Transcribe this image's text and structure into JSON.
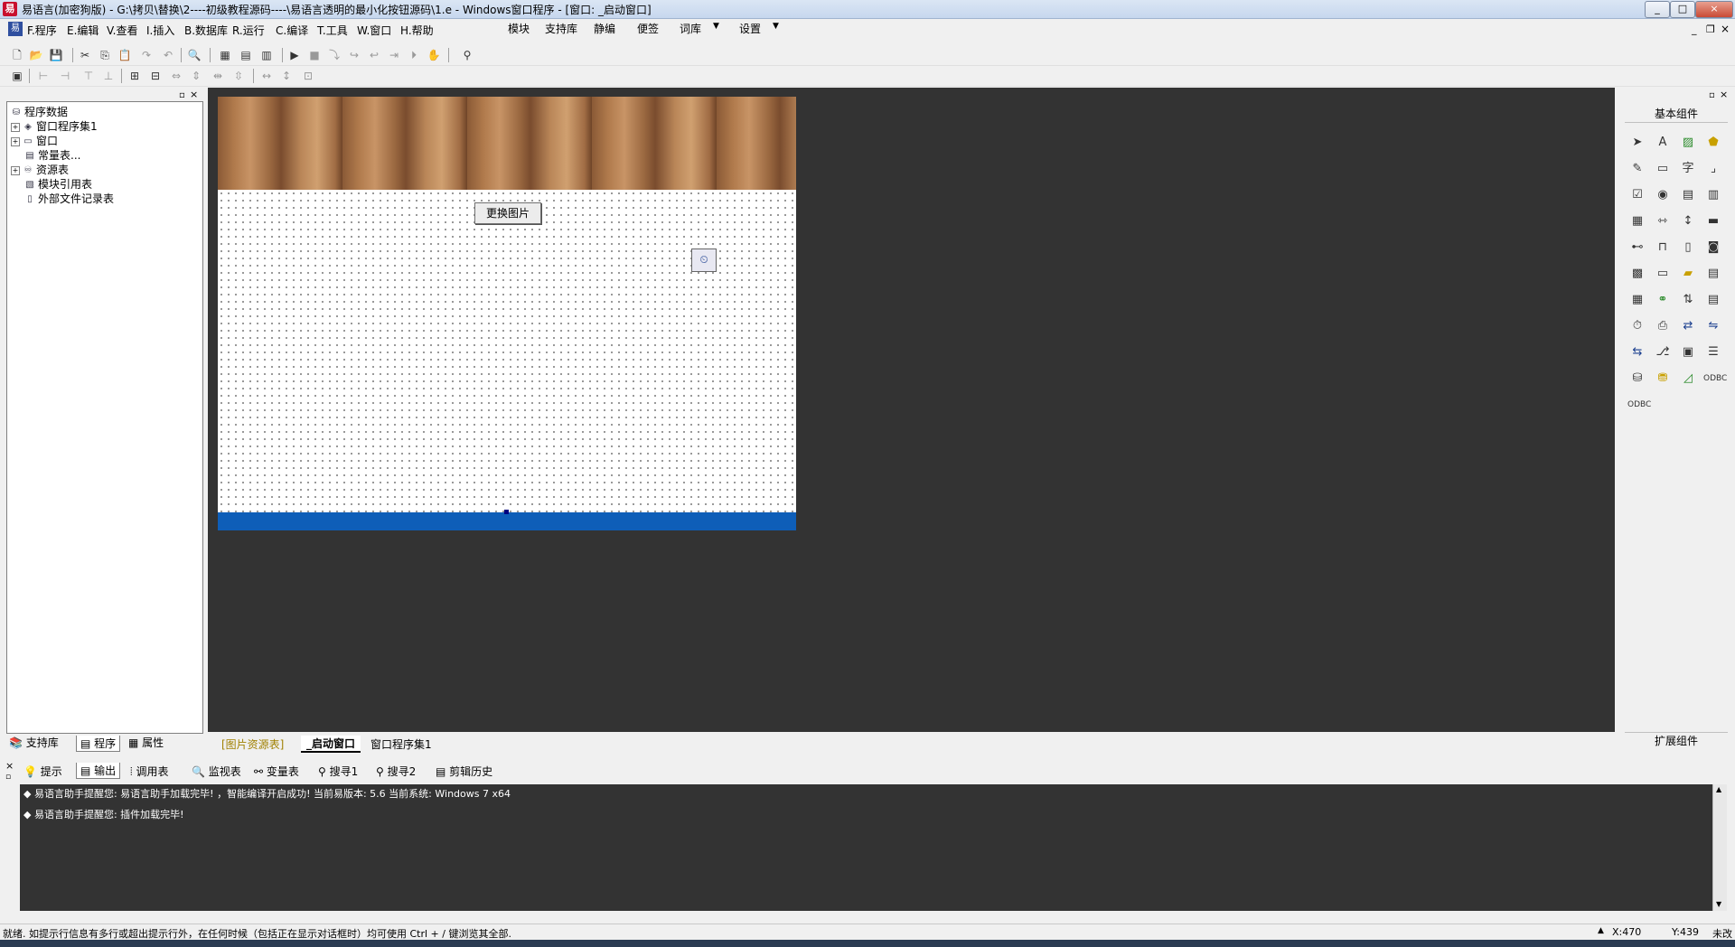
{
  "window": {
    "title": "易语言(加密狗版) - G:\\拷贝\\替换\\2----初级教程源码----\\易语言透明的最小化按钮源码\\1.e - Windows窗口程序 - [窗口: _启动窗口]",
    "min": "_",
    "max": "□",
    "close": "×"
  },
  "menu": {
    "items": [
      "F.程序",
      "E.编辑",
      "V.查看",
      "I.插入",
      "B.数据库",
      "R.运行",
      "C.编译",
      "T.工具",
      "W.窗口",
      "H.帮助"
    ],
    "right_items": [
      "模块",
      "支持库",
      "静编",
      "便签",
      "词库",
      "设置"
    ],
    "dropdown_arrow": "▼"
  },
  "left_panel": {
    "tree": [
      {
        "label": "程序数据",
        "expand": "",
        "icon": "database-icon"
      },
      {
        "label": "窗口程序集1",
        "expand": "+",
        "icon": "layers-icon"
      },
      {
        "label": "窗口",
        "expand": "+",
        "icon": "window-icon"
      },
      {
        "label": "常量表...",
        "expand": "",
        "icon": "table-icon"
      },
      {
        "label": "资源表",
        "expand": "+",
        "icon": "resource-icon"
      },
      {
        "label": "模块引用表",
        "expand": "",
        "icon": "module-icon"
      },
      {
        "label": "外部文件记录表",
        "expand": "",
        "icon": "file-icon"
      }
    ],
    "tabs": [
      "支持库",
      "程序",
      "属性"
    ]
  },
  "form": {
    "button_label": "更换图片",
    "timer_glyph": "⏲"
  },
  "editor_tabs": [
    "[图片资源表]",
    "_启动窗口",
    "窗口程序集1"
  ],
  "right_panel": {
    "header": "基本组件",
    "footer": "扩展组件"
  },
  "output": {
    "tabs": [
      "提示",
      "输出",
      "调用表",
      "监视表",
      "变量表",
      "搜寻1",
      "搜寻2",
      "剪辑历史"
    ],
    "lines": [
      "易语言助手提醒您: 易语言助手加载完毕! ，智能编译开启成功! 当前易版本: 5.6  当前系统: Windows 7 x64",
      "易语言助手提醒您: 插件加载完毕!"
    ],
    "bullet": "◆"
  },
  "status": {
    "message": "就绪. 如提示行信息有多行或超出提示行外，在任何时候（包括正在显示对话框时）均可使用 Ctrl + / 键浏览其全部.",
    "x": "X:470",
    "y": "Y:439",
    "mod": "未改"
  }
}
